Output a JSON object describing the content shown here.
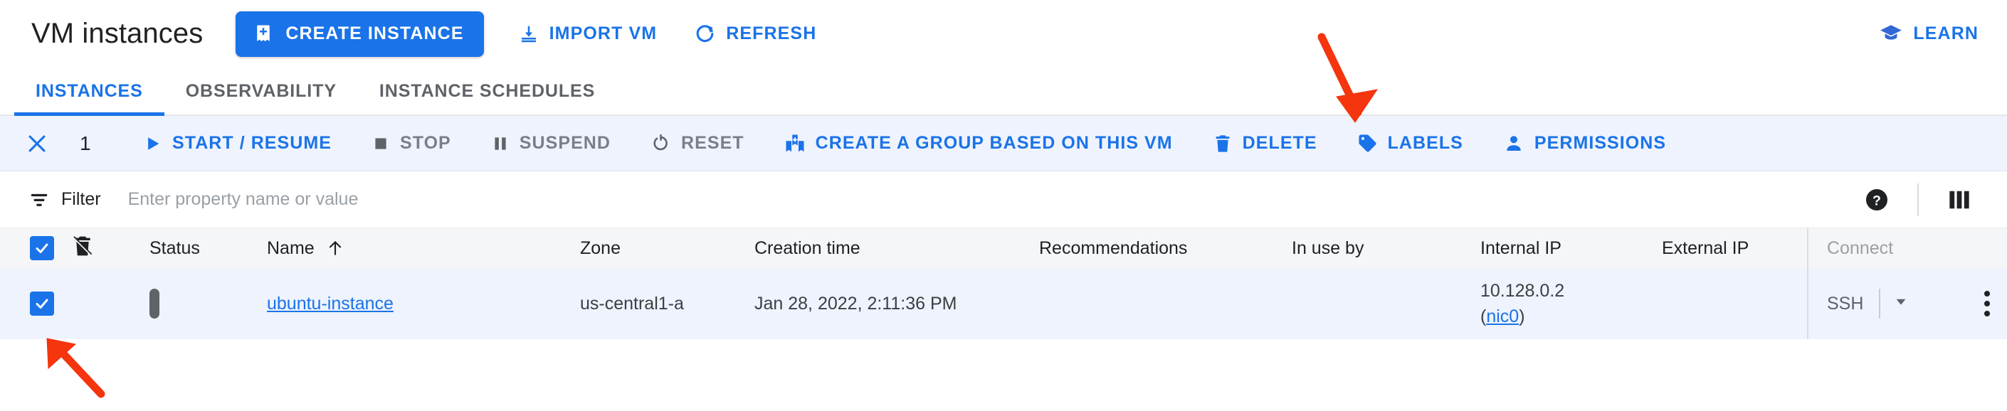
{
  "header": {
    "title": "VM instances",
    "create_label": "CREATE INSTANCE",
    "create_icon": "add-instance-icon",
    "import_label": "IMPORT VM",
    "import_icon": "import-download-icon",
    "refresh_label": "REFRESH",
    "refresh_icon": "refresh-icon",
    "learn_label": "LEARN",
    "learn_icon": "graduation-cap-icon",
    "accent_color": "#1a73e8"
  },
  "tabs": [
    {
      "label": "INSTANCES",
      "active": true
    },
    {
      "label": "OBSERVABILITY",
      "active": false
    },
    {
      "label": "INSTANCE SCHEDULES",
      "active": false
    }
  ],
  "toolbar": {
    "close_icon": "close-icon",
    "selected_count": "1",
    "actions": [
      {
        "label": "START / RESUME",
        "icon": "play-icon",
        "enabled": true
      },
      {
        "label": "STOP",
        "icon": "stop-square-icon",
        "enabled": false
      },
      {
        "label": "SUSPEND",
        "icon": "pause-icon",
        "enabled": false
      },
      {
        "label": "RESET",
        "icon": "power-reset-icon",
        "enabled": false
      },
      {
        "label": "CREATE A GROUP BASED ON THIS VM",
        "icon": "group-add-icon",
        "enabled": true
      },
      {
        "label": "DELETE",
        "icon": "trash-icon",
        "enabled": true
      },
      {
        "label": "LABELS",
        "icon": "label-tag-icon",
        "enabled": true
      },
      {
        "label": "PERMISSIONS",
        "icon": "person-icon",
        "enabled": true
      }
    ],
    "background_color": "#eef3fd"
  },
  "filter": {
    "label": "Filter",
    "icon": "filter-icon",
    "placeholder": "Enter property name or value",
    "value": "",
    "help_icon": "help-circle-icon",
    "columns_icon": "column-display-icon"
  },
  "table": {
    "columns": [
      {
        "key": "checkbox",
        "label": "",
        "icon": "select-all-checkbox"
      },
      {
        "key": "protection",
        "label": "",
        "icon": "delete-protection-icon"
      },
      {
        "key": "status",
        "label": "Status"
      },
      {
        "key": "name",
        "label": "Name",
        "sorted": true,
        "sort_icon": "arrow-up-icon"
      },
      {
        "key": "zone",
        "label": "Zone"
      },
      {
        "key": "creation_time",
        "label": "Creation time"
      },
      {
        "key": "recommendations",
        "label": "Recommendations"
      },
      {
        "key": "in_use_by",
        "label": "In use by"
      },
      {
        "key": "internal_ip",
        "label": "Internal IP"
      },
      {
        "key": "external_ip",
        "label": "External IP"
      },
      {
        "key": "connect",
        "label": "Connect",
        "muted": true
      }
    ],
    "rows": [
      {
        "selected": true,
        "status_icon": "stopped-icon",
        "name": "ubuntu-instance",
        "zone": "us-central1-a",
        "creation_time": "Jan 28, 2022, 2:11:36 PM",
        "recommendations": "",
        "in_use_by": "",
        "internal_ip": "10.128.0.2",
        "internal_ip_nic_open": "(",
        "internal_ip_nic": "nic0",
        "internal_ip_nic_close": ")",
        "external_ip": "",
        "connect_label": "SSH",
        "connect_caret_icon": "chevron-down-icon",
        "row_menu_icon": "more-vert-icon"
      }
    ]
  },
  "annotations": [
    {
      "name": "delete-arrow",
      "color": "#f4350e",
      "points_at": "DELETE"
    },
    {
      "name": "row-checkbox-arrow",
      "color": "#f4350e",
      "points_at": "row checkbox"
    }
  ]
}
